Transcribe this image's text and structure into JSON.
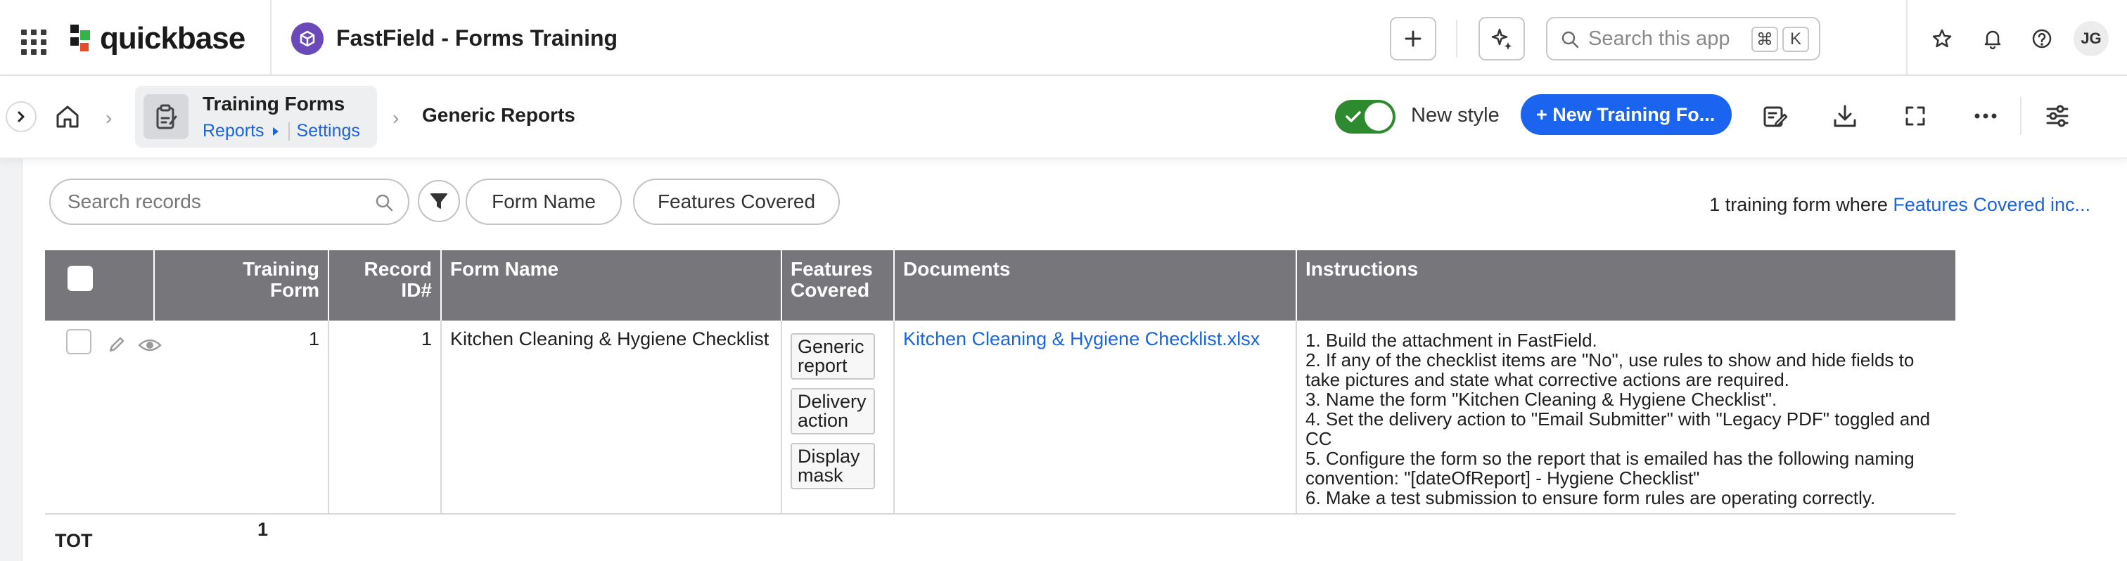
{
  "topbar": {
    "brand": "quickbase",
    "app_title": "FastField - Forms Training",
    "search_placeholder": "Search this app",
    "shortcut_mod": "⌘",
    "shortcut_key": "K",
    "avatar_initials": "JG"
  },
  "breadcrumb": {
    "table_name": "Training Forms",
    "reports_link": "Reports",
    "settings_link": "Settings",
    "report_name": "Generic Reports"
  },
  "toolbar": {
    "toggle_label": "New style",
    "toggle_on": true,
    "new_button_label": "+ New Training Fo..."
  },
  "filters": {
    "search_placeholder": "Search records",
    "pills": [
      "Form Name",
      "Features Covered"
    ],
    "summary_prefix": "1 training form where ",
    "summary_link": "Features Covered inc..."
  },
  "table": {
    "columns": [
      {
        "line1": "Training",
        "line2": "Form"
      },
      {
        "line1": "Record",
        "line2": "ID#"
      },
      {
        "line1": "Form Name",
        "line2": ""
      },
      {
        "line1": "Features",
        "line2": "Covered"
      },
      {
        "line1": "Documents",
        "line2": ""
      },
      {
        "line1": "Instructions",
        "line2": ""
      }
    ],
    "rows": [
      {
        "training_form": "1",
        "record_id": "1",
        "form_name": "Kitchen Cleaning & Hygiene Checklist",
        "features": [
          "Generic report",
          "Delivery action",
          "Display mask"
        ],
        "document": "Kitchen Cleaning & Hygiene Checklist.xlsx",
        "instructions": [
          "1. Build the attachment in FastField.",
          "2. If any of the checklist items are \"No\", use rules to show and hide fields to take pictures and state what corrective actions are required.",
          "3. Name the form \"Kitchen Cleaning & Hygiene Checklist\".",
          "4. Set the delivery action to \"Email Submitter\" with \"Legacy PDF\" toggled and CC",
          "5. Configure the form so the report that is emailed has the following naming convention: \"[dateOfReport] - Hygiene Checklist\"",
          "6. Make a test submission to ensure form rules are operating correctly."
        ]
      }
    ],
    "totals": {
      "label": "TOT",
      "training_form": "1"
    }
  },
  "colors": {
    "accent": "#1b64f0",
    "link": "#1b64da",
    "header_bg": "#77777b",
    "toggle_on": "#2e8a2e",
    "app_badge": "#6b49b8"
  }
}
